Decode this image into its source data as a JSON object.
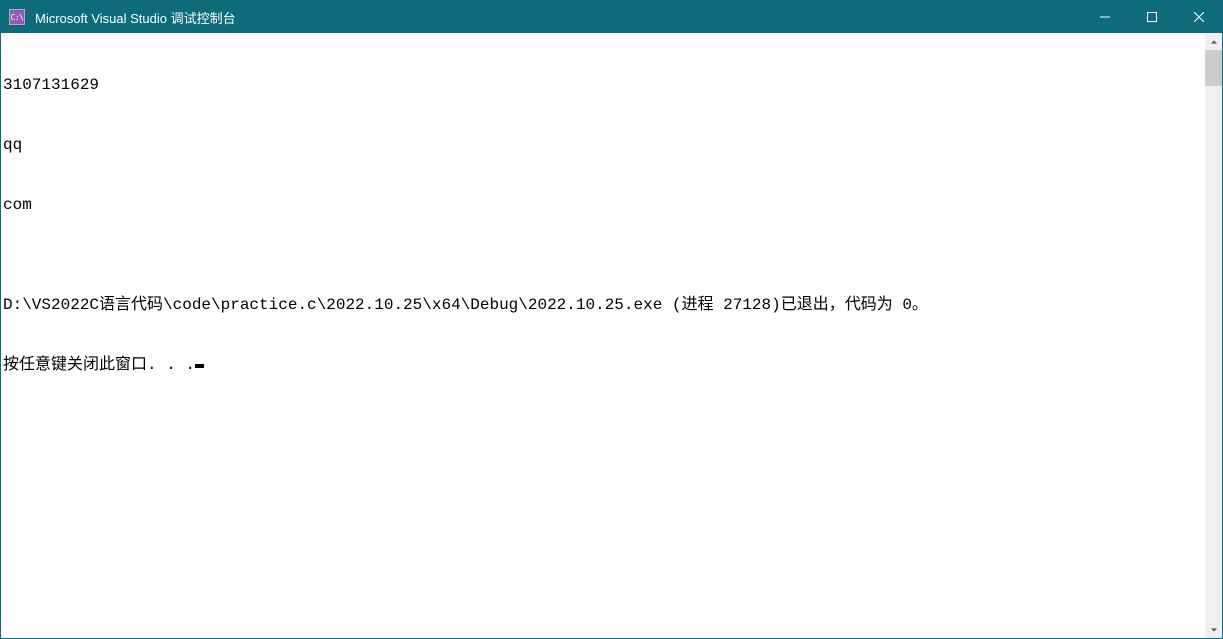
{
  "titlebar": {
    "icon_text": "C:\\",
    "title": "Microsoft Visual Studio 调试控制台"
  },
  "console": {
    "lines": [
      "3107131629",
      "qq",
      "com",
      "",
      "D:\\VS2022C语言代码\\code\\practice.c\\2022.10.25\\x64\\Debug\\2022.10.25.exe (进程 27128)已退出，代码为 0。",
      "按任意键关闭此窗口. . ."
    ]
  }
}
